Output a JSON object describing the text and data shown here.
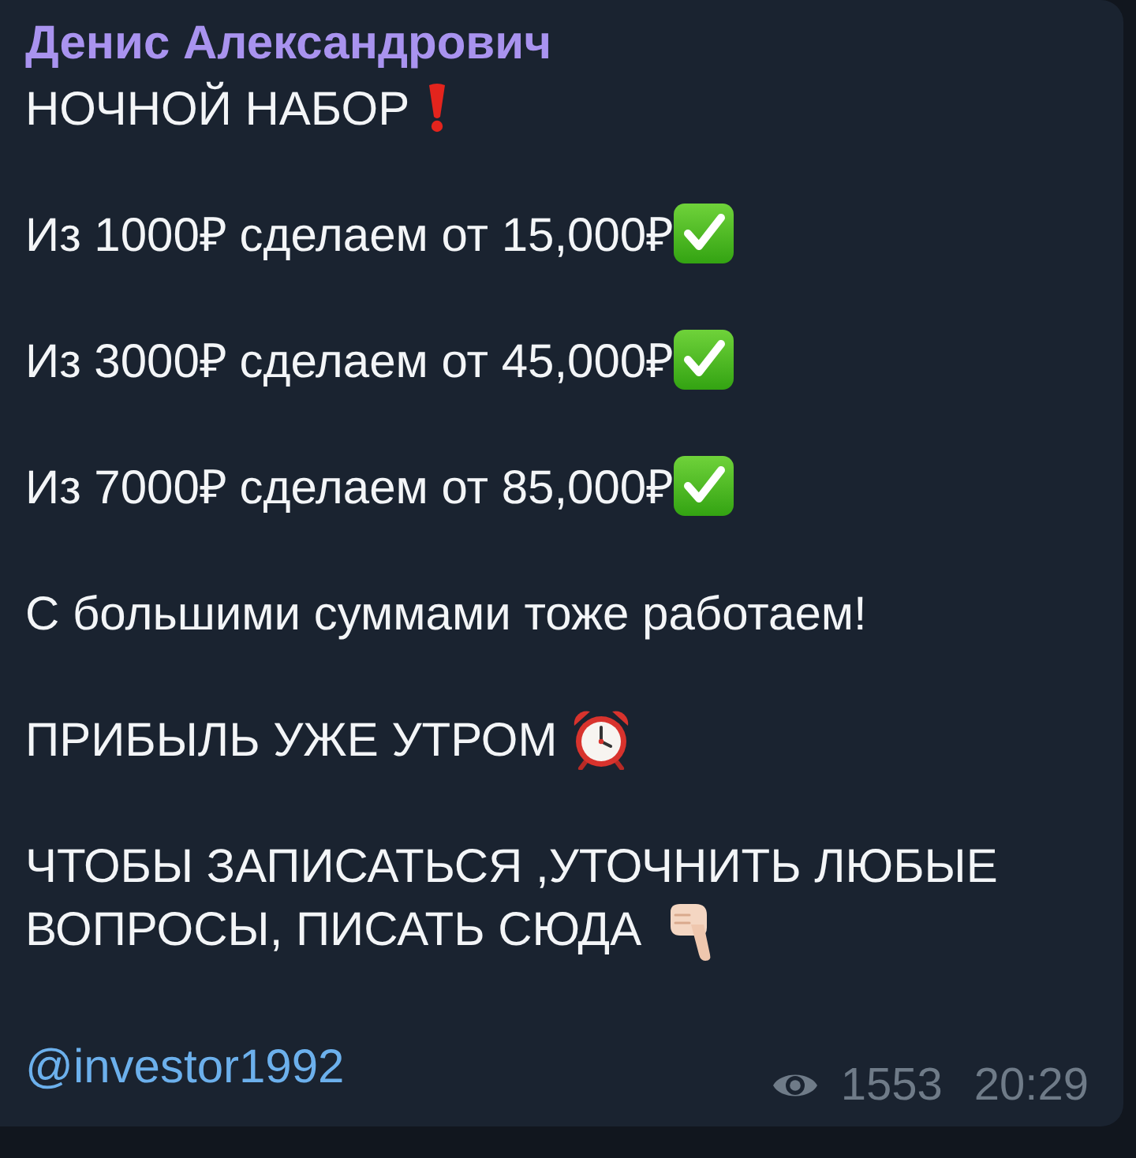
{
  "message": {
    "sender": "Денис Александрович",
    "paragraphs": [
      {
        "lines": [
          "НОЧНОЙ НАБОР"
        ],
        "kind": "exclamation"
      },
      {
        "lines": [
          "Из 1000₽ сделаем от 15,000₽"
        ],
        "kind": "check"
      },
      {
        "lines": [
          "Из 3000₽ сделаем от 45,000₽"
        ],
        "kind": "check"
      },
      {
        "lines": [
          "Из 7000₽ сделаем от 85,000₽"
        ],
        "kind": "check"
      },
      {
        "lines": [
          "С большими суммами тоже работаем!"
        ],
        "kind": "plain"
      },
      {
        "lines": [
          "ПРИБЫЛЬ УЖЕ УТРОМ"
        ],
        "kind": "alarm"
      },
      {
        "lines": [
          "ЧТОБЫ ЗАПИСАТЬСЯ ,УТОЧНИТЬ ЛЮБЫЕ",
          "ВОПРОСЫ, ПИСАТЬ СЮДА"
        ],
        "kind": "pointing"
      }
    ],
    "link": "@investor1992",
    "views": "1553",
    "time": "20:29"
  }
}
